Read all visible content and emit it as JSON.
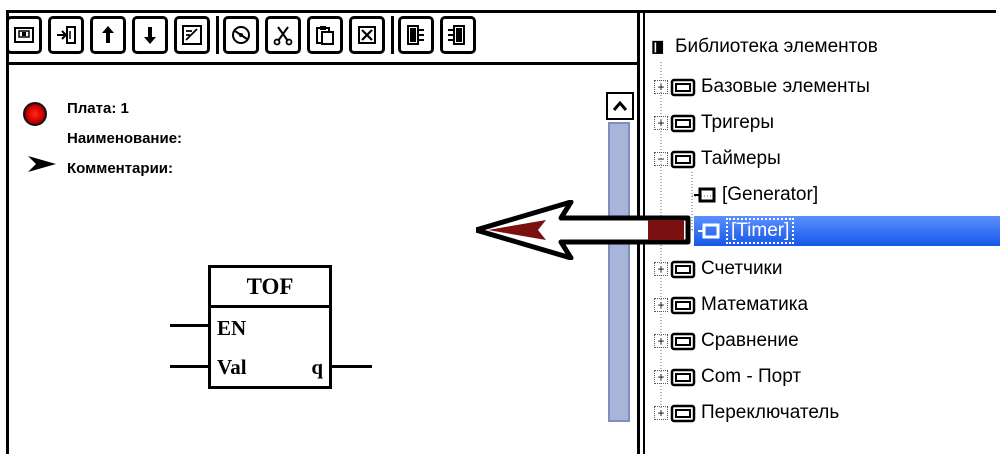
{
  "toolbar": {
    "buttons": [
      "save-icon",
      "insert-icon",
      "move-up-icon",
      "move-down-icon",
      "edit-icon",
      "disk-icon",
      "cut-icon",
      "paste-icon",
      "delete-icon",
      "align-left-icon",
      "align-right-icon"
    ]
  },
  "info": {
    "board": "Плата: 1",
    "name_label": "Наименование:",
    "comments_label": "Комментарии:"
  },
  "block": {
    "title": "TOF",
    "input1": "EN",
    "input2": "Val",
    "output": "q"
  },
  "tree": {
    "root": "Библиотека элементов",
    "items": [
      {
        "label": "Базовые элементы"
      },
      {
        "label": "Тригеры"
      },
      {
        "label": "Таймеры"
      },
      {
        "label": "[Generator]"
      },
      {
        "label": "[Timer]"
      },
      {
        "label": "Счетчики"
      },
      {
        "label": "Математика"
      },
      {
        "label": "Сравнение"
      },
      {
        "label": "Com - Порт"
      },
      {
        "label": "Переключатель"
      }
    ]
  },
  "colors": {
    "selection": "#1757e8",
    "indicator": "#d00000",
    "scroll_thumb": "#a9b5d8"
  }
}
